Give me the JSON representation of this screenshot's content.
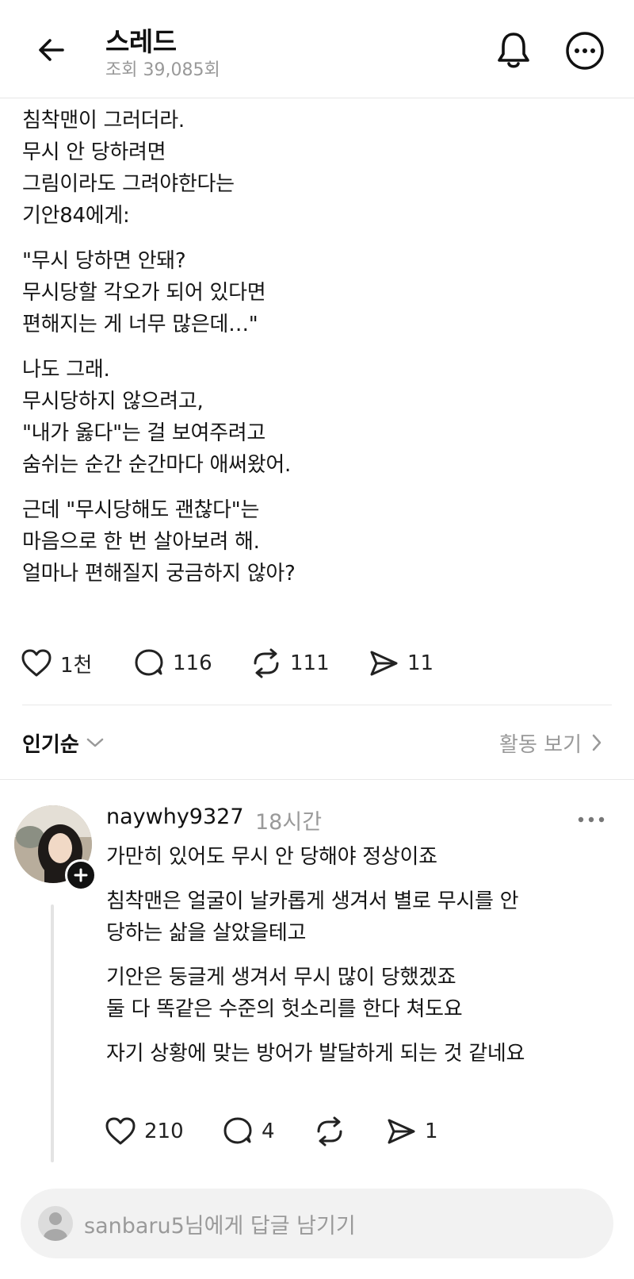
{
  "header": {
    "title": "스레드",
    "views": "조회 39,085회"
  },
  "post": {
    "paragraphs": [
      [
        "침착맨이 그러더라.",
        "무시 안 당하려면",
        "그림이라도 그려야한다는",
        "기안84에게:"
      ],
      [
        "\"무시 당하면 안돼?",
        "무시당할 각오가 되어 있다면",
        "편해지는 게 너무 많은데…\""
      ],
      [
        "나도 그래.",
        "무시당하지 않으려고,",
        "\"내가 옳다\"는 걸 보여주려고",
        "숨쉬는 순간 순간마다 애써왔어."
      ],
      [
        "근데 \"무시당해도 괜찮다\"는",
        "마음으로 한 번 살아보려 해.",
        "얼마나 편해질지 궁금하지 않아?"
      ]
    ],
    "likes": "1천",
    "comments": "116",
    "reposts": "111",
    "shares": "11"
  },
  "sort": {
    "label": "인기순",
    "activity_label": "활동 보기"
  },
  "comment": {
    "username": "naywhy9327",
    "time": "18시간",
    "paragraphs": [
      [
        "가만히 있어도 무시 안 당해야 정상이죠"
      ],
      [
        "침착맨은 얼굴이 날카롭게 생겨서 별로 무시를 안",
        "당하는 삶을 살았을테고"
      ],
      [
        "기안은 둥글게 생겨서 무시 많이 당했겠죠",
        "둘 다 똑같은 수준의 헛소리를 한다 쳐도요"
      ],
      [
        "자기 상황에 맞는 방어가 발달하게 되는 것 같네요"
      ]
    ],
    "likes": "210",
    "comments": "4",
    "shares": "1"
  },
  "reply": {
    "placeholder": "sanbaru5님에게 답글 남기기"
  },
  "icons": {
    "back": "back-arrow-icon",
    "notifications": "bell-icon",
    "more": "more-icon",
    "like": "heart-icon",
    "comment": "comment-icon",
    "repost": "repost-icon",
    "share": "send-icon"
  },
  "colors": {
    "text": "#111111",
    "muted": "#999999",
    "divider": "#e8e8e8",
    "reply_bg": "#f2f2f2"
  }
}
